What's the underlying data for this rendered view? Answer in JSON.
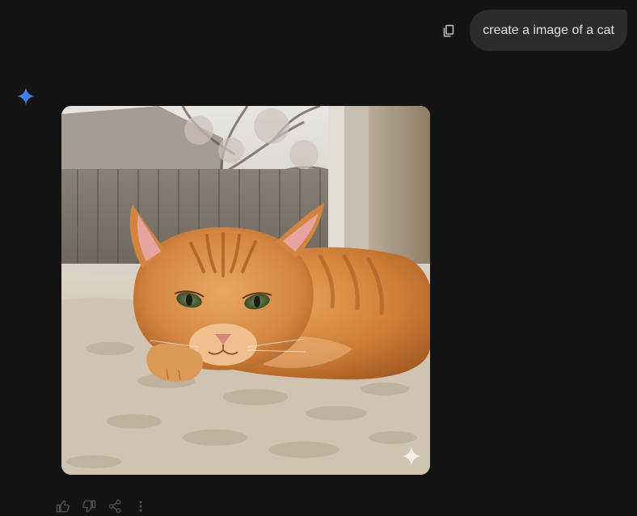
{
  "prompt": {
    "text": "create a image of a cat",
    "copy_icon": "copy-icon"
  },
  "response": {
    "avatar_icon": "gemini-sparkle-icon",
    "image": {
      "subject": "orange tabby cat lying on a fleece blanket by a window",
      "watermark_icon": "sparkle-watermark-icon"
    },
    "actions": [
      {
        "icon": "thumbs-up-icon"
      },
      {
        "icon": "thumbs-down-icon"
      },
      {
        "icon": "share-icon"
      },
      {
        "icon": "more-vert-icon"
      }
    ]
  },
  "colors": {
    "background": "#131314",
    "bubble": "#2a2b2d",
    "text": "#e3e3e3",
    "accent": "#4285f4"
  }
}
